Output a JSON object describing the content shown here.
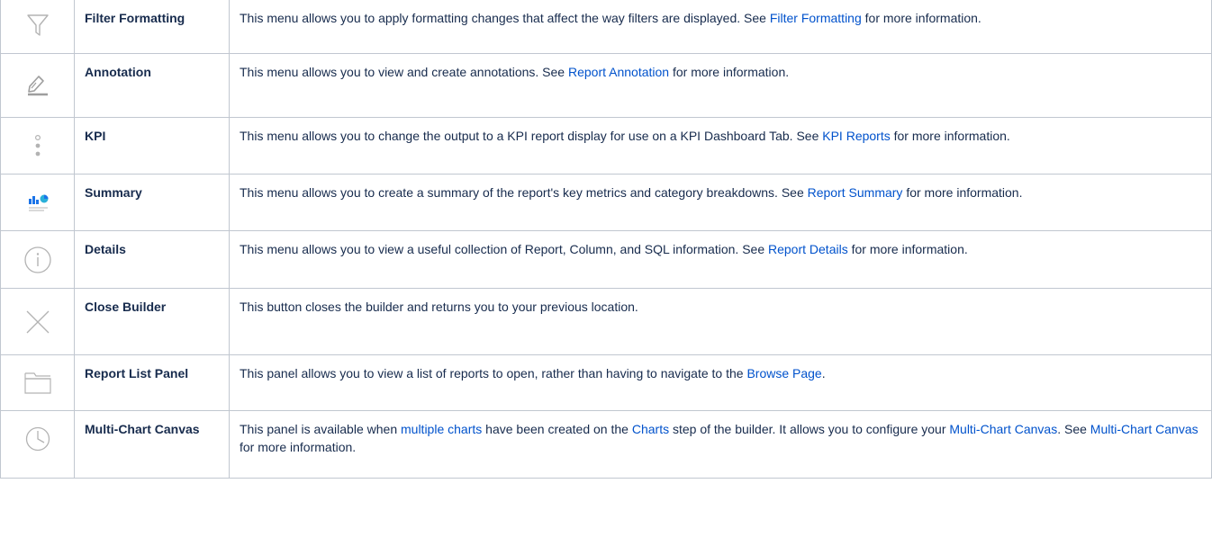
{
  "rows": [
    {
      "icon": "filter-icon",
      "name": "Filter Formatting",
      "text1": "This menu allows you to apply formatting changes that affect the way filters are displayed. See ",
      "link1": "Filter Formatting",
      "text2": " for more information."
    },
    {
      "icon": "annotation-pen-icon",
      "name": "Annotation",
      "text1": "This menu allows you to view and create annotations. See ",
      "link1": "Report Annotation",
      "text2": " for more information."
    },
    {
      "icon": "kpi-dots-icon",
      "name": "KPI",
      "text1": "This menu allows you to change the output to a KPI report display for use on a KPI Dashboard Tab. See ",
      "link1": "KPI Reports",
      "text2": " for more information."
    },
    {
      "icon": "summary-chart-icon",
      "name": "Summary",
      "text1": "This menu allows you to create a summary of the report's key metrics and category breakdowns. See ",
      "link1": "Report Summary",
      "text2": " for more information."
    },
    {
      "icon": "info-icon",
      "name": "Details",
      "text1": "This menu allows you to view a useful collection of Report, Column, and SQL information. See ",
      "link1": "Report Details",
      "text2": " for more information."
    },
    {
      "icon": "close-icon",
      "name": "Close Builder",
      "text1": "This button closes the builder and returns you to your previous location."
    },
    {
      "icon": "folder-icon",
      "name": "Report List Panel",
      "text1": "This panel allows you to view a list of reports to open, rather than having to navigate to the ",
      "link1": "Browse Page",
      "text2": "."
    },
    {
      "icon": "multi-chart-clock-icon",
      "name": "Multi-Chart Canvas",
      "text1": "This panel is available when ",
      "link1": "multiple charts",
      "text2": " have been created on the ",
      "link2": "Charts",
      "text3": " step of the builder. It allows you to configure your ",
      "link3": "Multi-Chart Canvas",
      "text4": ". See ",
      "link4": "Multi-Chart Canvas",
      "text5": " for more information."
    }
  ],
  "colors": {
    "link": "#0052cc",
    "text": "#172b4d",
    "border": "#c1c7d0",
    "icon_stroke": "#b3b3b3",
    "summary_blue": "#1a73e8",
    "summary_teal": "#2ab0d9"
  }
}
